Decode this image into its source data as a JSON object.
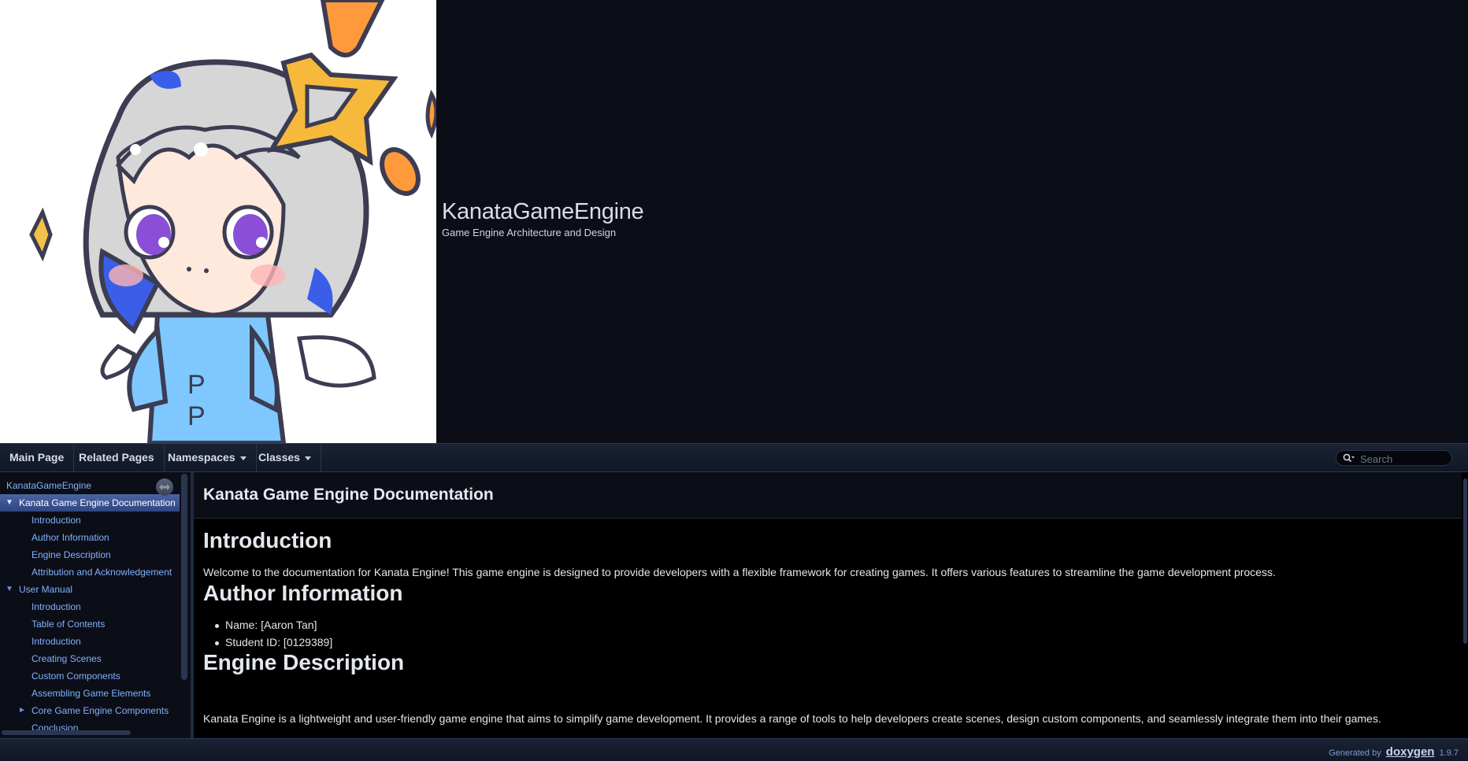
{
  "header": {
    "project_name": "KanataGameEngine",
    "project_brief": "Game Engine Architecture and Design"
  },
  "navbar": {
    "items": [
      {
        "label": "Main Page"
      },
      {
        "label": "Related Pages"
      },
      {
        "label": "Namespaces"
      },
      {
        "label": "Classes"
      }
    ],
    "search_placeholder": "Search"
  },
  "sidenav": {
    "items": [
      {
        "label": "KanataGameEngine"
      },
      {
        "label": "Kanata Game Engine Documentation"
      },
      {
        "label": "Introduction"
      },
      {
        "label": "Author Information"
      },
      {
        "label": "Engine Description"
      },
      {
        "label": "Attribution and Acknowledgement"
      },
      {
        "label": "User Manual"
      },
      {
        "label": "Introduction"
      },
      {
        "label": "Table of Contents"
      },
      {
        "label": "Introduction"
      },
      {
        "label": "Creating Scenes"
      },
      {
        "label": "Custom Components"
      },
      {
        "label": "Assembling Game Elements"
      },
      {
        "label": "Core Game Engine Components"
      },
      {
        "label": "Conclusion"
      }
    ]
  },
  "content": {
    "title": "Kanata Game Engine Documentation",
    "sections": [
      {
        "heading": "Introduction",
        "text": "Welcome to the documentation for Kanata Engine! This game engine is designed to provide developers with a flexible framework for creating games. It offers various features to streamline the game development process."
      },
      {
        "heading": "Author Information",
        "bullets": [
          "Name: [Aaron Tan]",
          "Student ID: [0129389]"
        ]
      },
      {
        "heading": "Engine Description",
        "text": "Kanata Engine is a lightweight and user-friendly game engine that aims to simplify game development. It provides a range of tools to help developers create scenes, design custom components, and seamlessly integrate them into their games."
      }
    ]
  },
  "footer": {
    "generated_by": "Generated by",
    "brand": "doxygen",
    "version": "1.9.7"
  },
  "colors": {
    "background": "#0b0e16",
    "link": "#82b1ff",
    "selected": "#3c5592"
  }
}
